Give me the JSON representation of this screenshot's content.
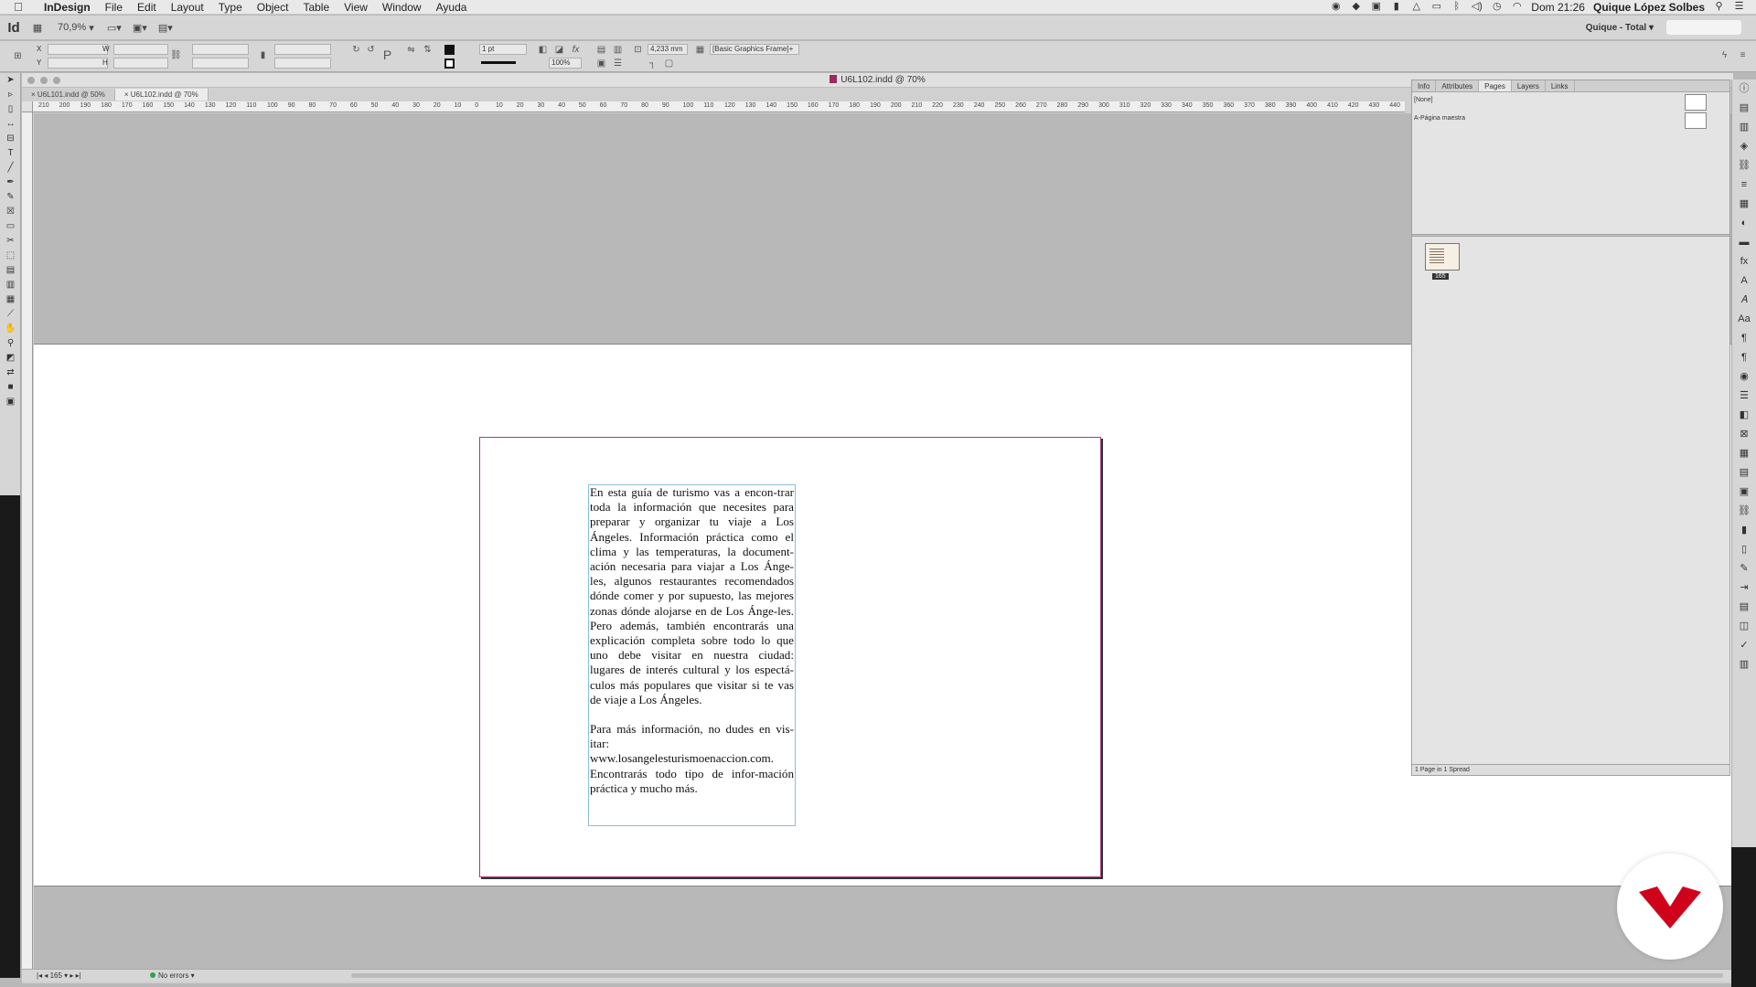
{
  "menubar": {
    "app_name": "InDesign",
    "items": [
      "File",
      "Edit",
      "Layout",
      "Type",
      "Object",
      "Table",
      "View",
      "Window",
      "Ayuda"
    ],
    "clock": "Dom 21:26",
    "user": "Quique López Solbes"
  },
  "appbar": {
    "logo": "Id",
    "zoom": "70,9%",
    "workspace": "Quique - Total"
  },
  "control_panel": {
    "stroke_weight": "1 pt",
    "opacity": "100%",
    "gap": "4,233 mm",
    "object_style": "[Basic Graphics Frame]+"
  },
  "document": {
    "window_title": "U6L102.indd @ 70%",
    "tabs": [
      {
        "label": "U6L101.indd @ 50%",
        "active": false
      },
      {
        "label": "U6L102.indd @ 70%",
        "active": true
      }
    ],
    "ruler_labels": [
      "210",
      "200",
      "190",
      "180",
      "170",
      "160",
      "150",
      "140",
      "130",
      "120",
      "110",
      "100",
      "90",
      "80",
      "70",
      "60",
      "50",
      "40",
      "30",
      "20",
      "10",
      "0",
      "10",
      "20",
      "30",
      "40",
      "50",
      "60",
      "70",
      "80",
      "90",
      "100",
      "110",
      "120",
      "130",
      "140",
      "150",
      "160",
      "170",
      "180",
      "190",
      "200",
      "210",
      "220",
      "230",
      "240",
      "250",
      "260",
      "270",
      "280",
      "290",
      "300",
      "310",
      "320",
      "330",
      "340",
      "350",
      "360",
      "370",
      "380",
      "390",
      "400",
      "410",
      "420",
      "430",
      "440"
    ],
    "text_frame": {
      "paragraph1": "En esta guía de turismo vas a encon-trar toda la información que necesites para preparar y organizar tu viaje a Los Ángeles. Información práctica como el clima y las temperaturas, la document-ación necesaria para viajar a Los Ánge-les, algunos restaurantes recomendados dónde comer y por supuesto, las mejores zonas dónde alojarse en de Los Ánge-les. Pero además, también encontrarás una explicación completa sobre todo lo que uno debe visitar en nuestra ciudad: lugares de interés cultural y los espectá-culos más populares que visitar si te vas de viaje a Los Ángeles.",
      "paragraph2": "Para más información, no dudes en vis-itar: www.losangelesturismoenaccion.com. Encontrarás todo tipo de infor-mación práctica y mucho más."
    }
  },
  "statusbar": {
    "page": "165",
    "preflight": "No errors"
  },
  "pages_panel": {
    "tabs": [
      {
        "label": "Info",
        "active": false
      },
      {
        "label": "Attributes",
        "active": false
      },
      {
        "label": "Pages",
        "active": true
      },
      {
        "label": "Layers",
        "active": false
      },
      {
        "label": "Links",
        "active": false
      }
    ],
    "masters": [
      "[None]",
      "A-Página maestra"
    ],
    "page_number": "165",
    "footer": "1 Page in 1 Spread"
  },
  "colors": {
    "page_border": "#a23c86",
    "frame_border": "#8cc0d8",
    "logo_red": "#d0021b"
  }
}
